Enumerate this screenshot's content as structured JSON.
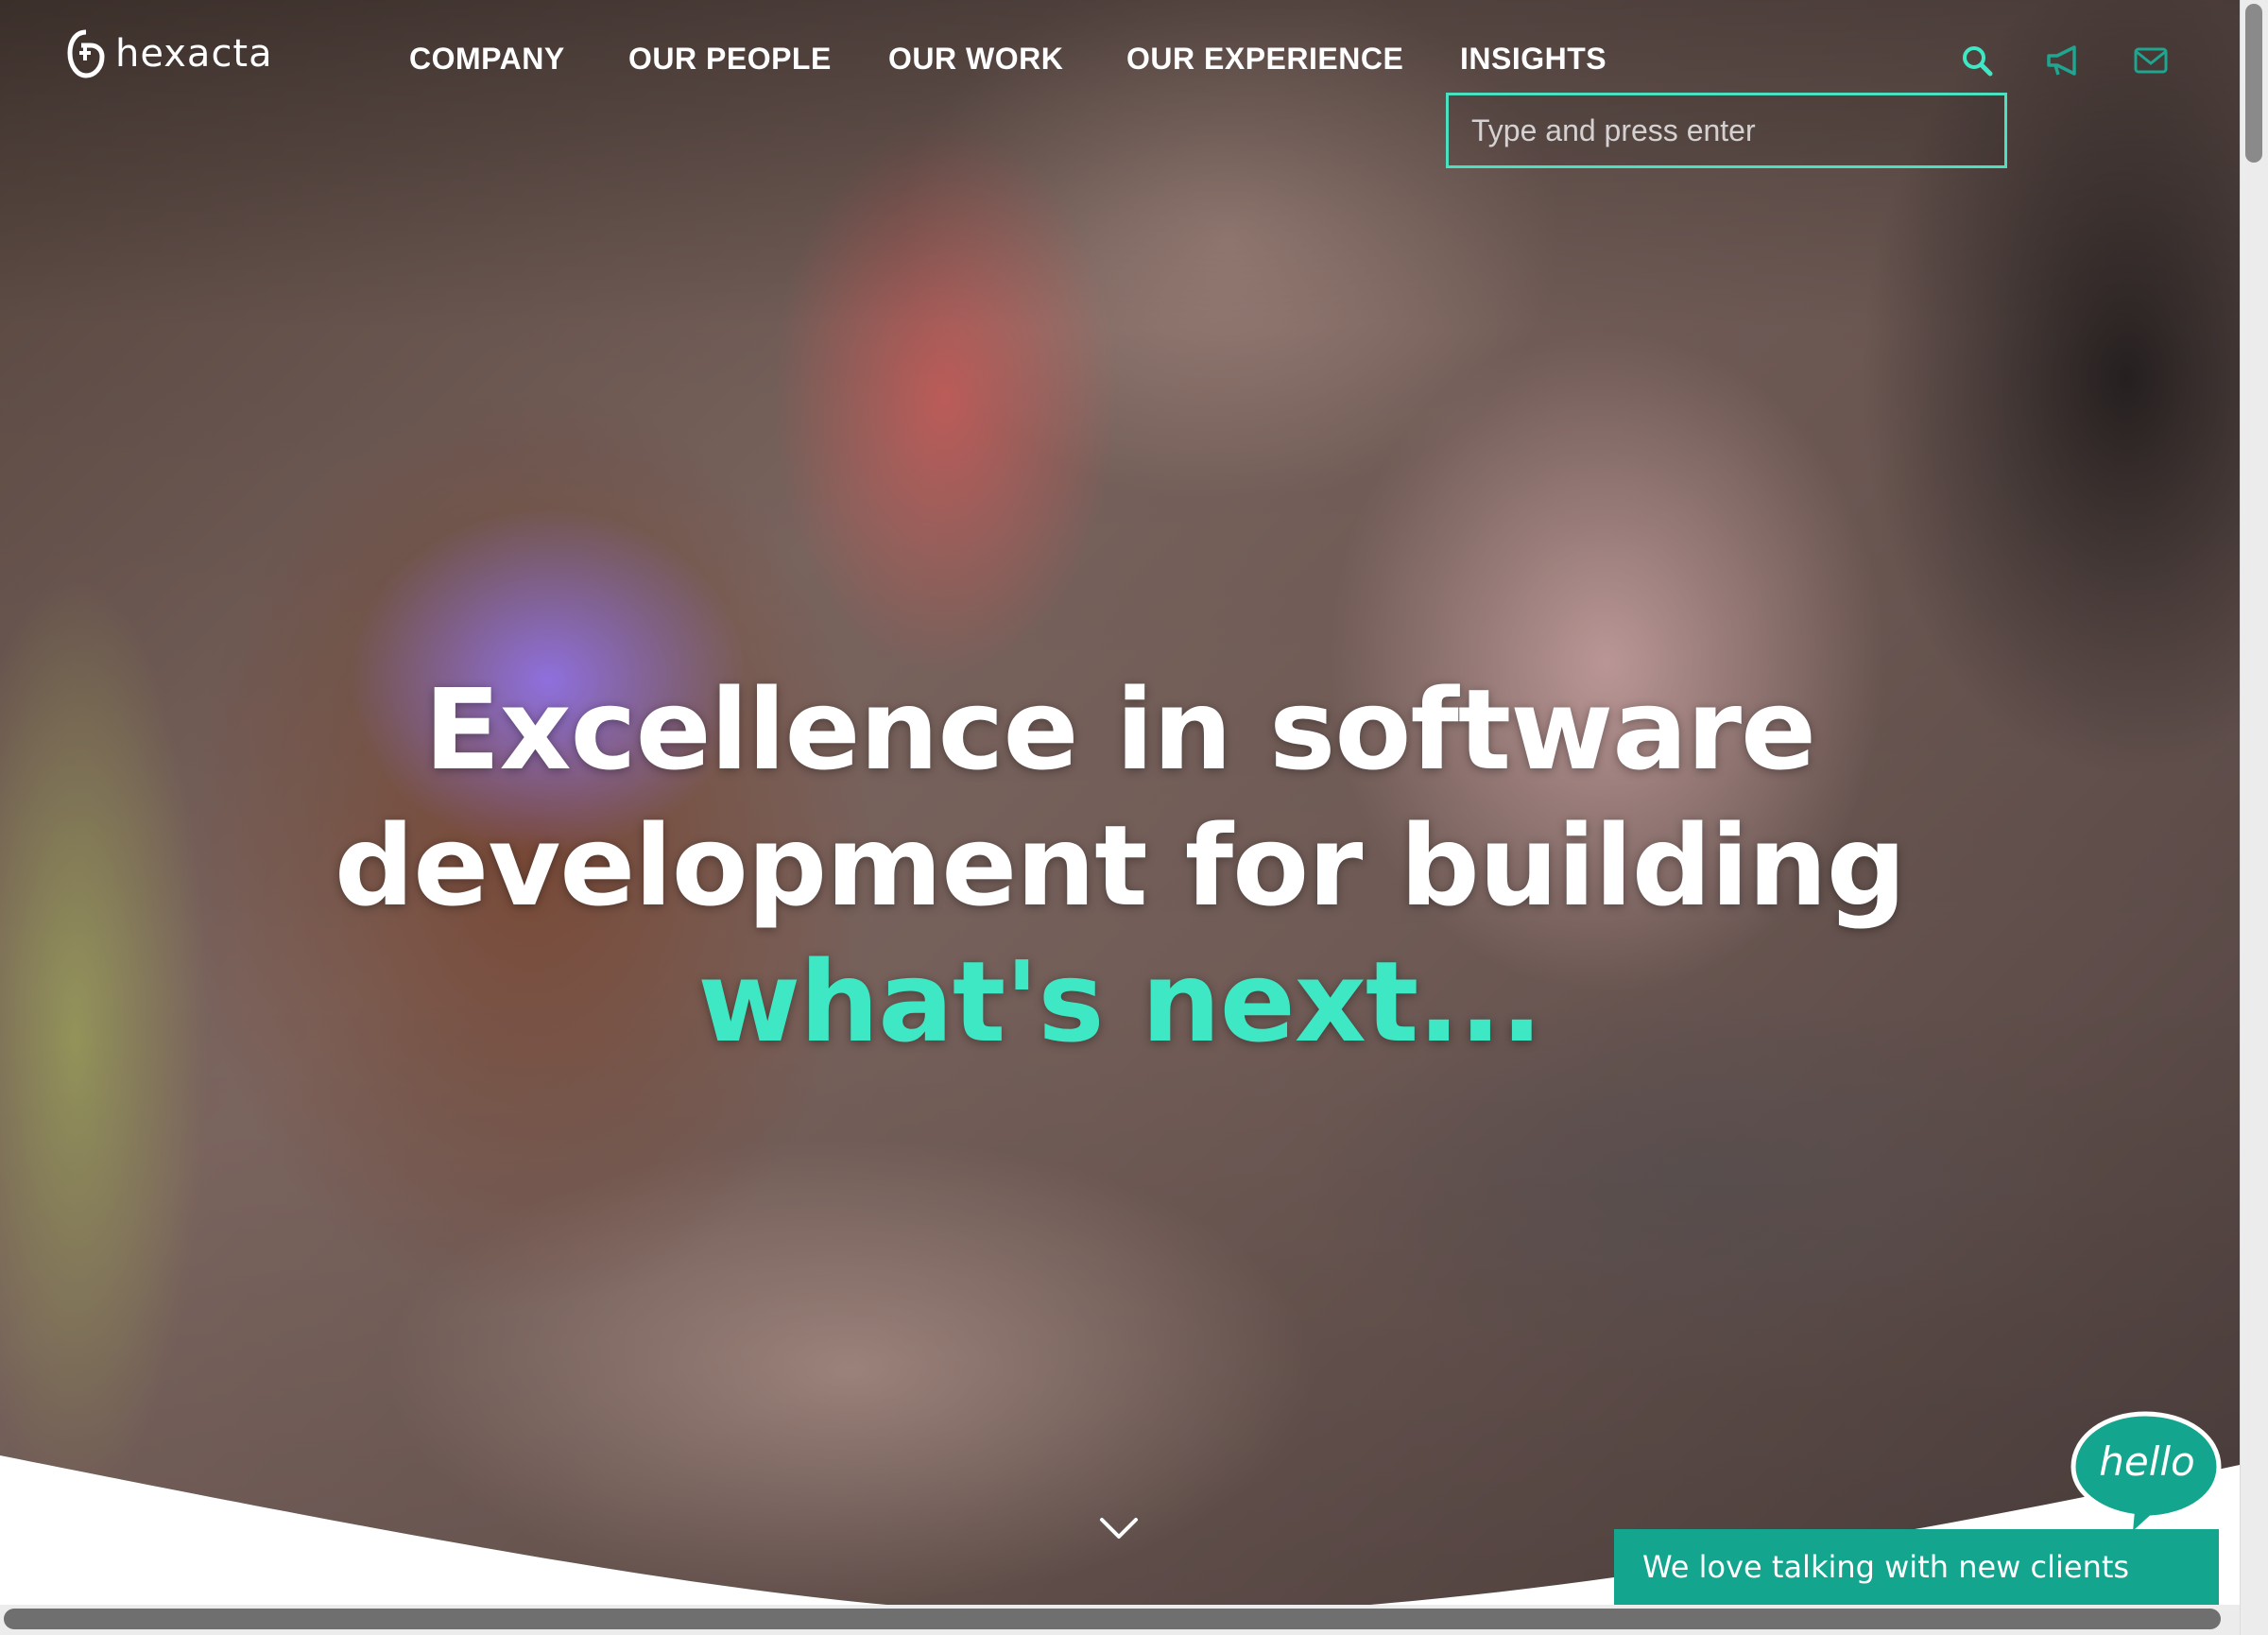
{
  "brand": {
    "name": "hexacta",
    "accent_color": "#3fe8c4",
    "chat_color": "#13a58e"
  },
  "nav": {
    "items": [
      {
        "label": "COMPANY"
      },
      {
        "label": "OUR PEOPLE"
      },
      {
        "label": "OUR WORK"
      },
      {
        "label": "OUR EXPERIENCE"
      },
      {
        "label": "INSIGHTS"
      }
    ]
  },
  "header_icons": {
    "search": "search-icon",
    "announcements": "megaphone-icon",
    "contact": "envelope-icon"
  },
  "search": {
    "placeholder": "Type and press enter",
    "value": ""
  },
  "hero": {
    "line1": "Excellence in software",
    "line2": "development for building",
    "line3_accent": "what's next..."
  },
  "chat": {
    "bubble_text": "hello",
    "bar_text": "We love talking with new clients"
  },
  "scroll": {
    "icon": "chevron-down-icon"
  }
}
